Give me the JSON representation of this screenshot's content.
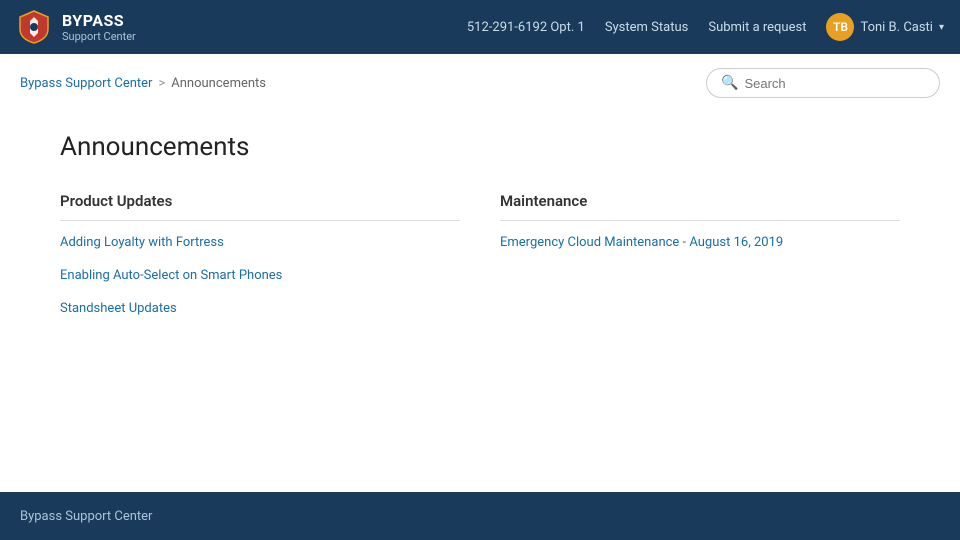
{
  "header": {
    "brand_name": "BYPASS",
    "brand_sub": "Support Center",
    "phone": "512-291-6192 Opt. 1",
    "system_status": "System Status",
    "submit_request": "Submit a request",
    "user_name": "Toni B. Casti",
    "user_initials": "TB"
  },
  "breadcrumb": {
    "home": "Bypass Support Center",
    "separator": ">",
    "current": "Announcements"
  },
  "search": {
    "placeholder": "Search"
  },
  "main": {
    "page_title": "Announcements",
    "sections": [
      {
        "id": "product-updates",
        "title": "Product Updates",
        "articles": [
          {
            "title": "Adding Loyalty with Fortress"
          },
          {
            "title": "Enabling Auto-Select on Smart Phones"
          },
          {
            "title": "Standsheet Updates"
          }
        ]
      },
      {
        "id": "maintenance",
        "title": "Maintenance",
        "articles": [
          {
            "title": "Emergency Cloud Maintenance - August 16, 2019"
          }
        ]
      }
    ]
  },
  "footer": {
    "text": "Bypass Support Center"
  }
}
